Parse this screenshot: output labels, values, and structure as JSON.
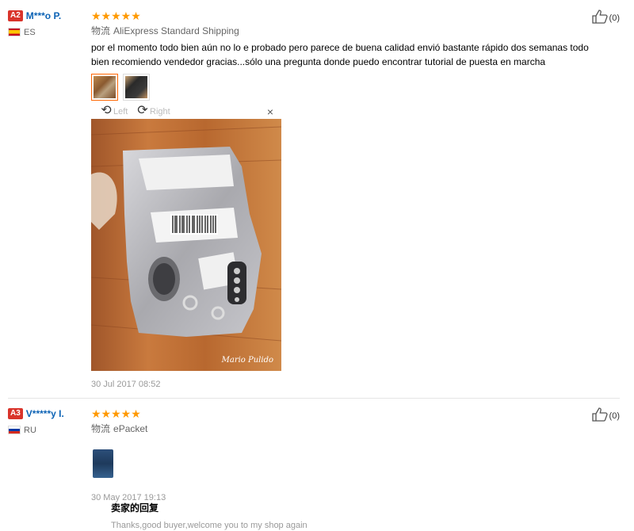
{
  "reviews": [
    {
      "level": "A2",
      "user": "M***o P.",
      "country": "ES",
      "stars": "★★★★★",
      "rating": 5,
      "shipping_label": "物流",
      "shipping_method": "AliExpress Standard Shipping",
      "text": "por el momento todo bien aún no lo e probado pero parece de buena calidad envió bastante rápido dos semanas todo bien recomiendo vendedor gracias...sólo una pregunta donde puedo encontrar tutorial de puesta en marcha",
      "images": [
        "photo-1",
        "photo-2"
      ],
      "viewer": {
        "rotate_left": "Left",
        "rotate_right": "Right",
        "close": "×",
        "watermark": "Mario Pulido"
      },
      "date": "30 Jul 2017 08:52",
      "likes": "(0)"
    },
    {
      "level": "A3",
      "user": "V*****y I.",
      "country": "RU",
      "stars": "★★★★★",
      "rating": 5,
      "shipping_label": "物流",
      "shipping_method": "ePacket",
      "images": [
        "photo-1"
      ],
      "date": "30 May 2017 19:13",
      "likes": "(0)",
      "seller_reply": {
        "title": "卖家的回复",
        "text": "Thanks,good buyer,welcome you to my shop again"
      }
    }
  ],
  "colors": {
    "level_badge": "#d9342b",
    "username": "#0d63b5",
    "stars": "#ff9900",
    "active_thumb_border": "#ff6600"
  }
}
